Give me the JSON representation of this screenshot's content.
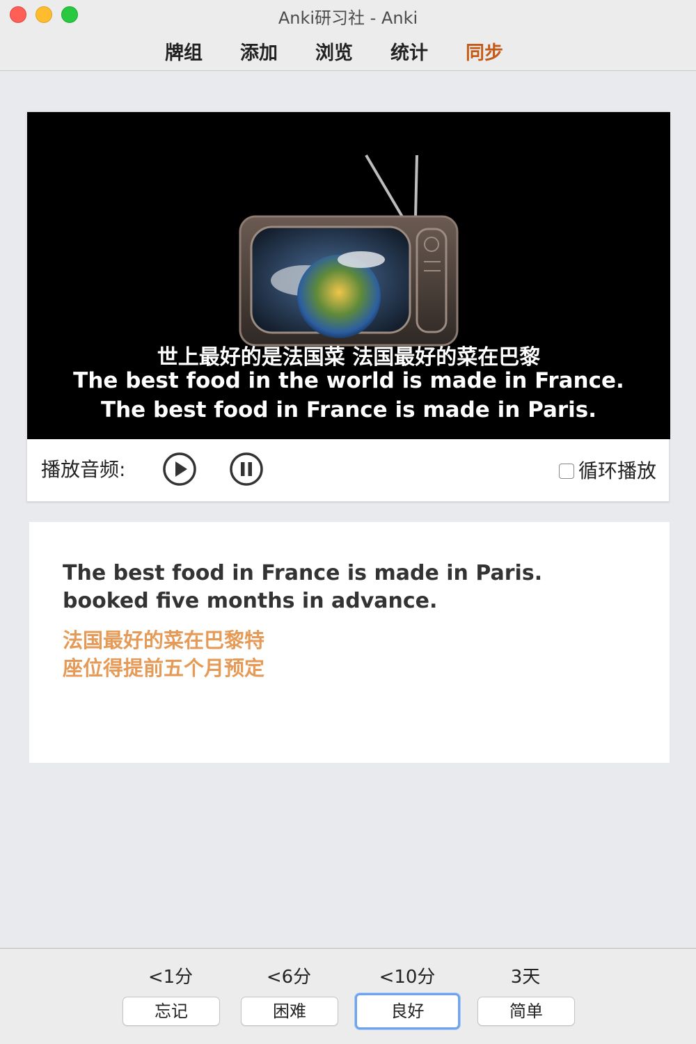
{
  "window": {
    "title": "Anki研习社 - Anki"
  },
  "toolbar": {
    "items": [
      {
        "label": "牌组"
      },
      {
        "label": "添加"
      },
      {
        "label": "浏览"
      },
      {
        "label": "统计"
      },
      {
        "label": "同步",
        "active": true
      }
    ],
    "active_color": "#c35a17"
  },
  "video": {
    "subtitles": [
      "世上最好的是法国菜 法国最好的菜在巴黎",
      "The best food in the world is made in France.",
      "The best food in France is made in Paris."
    ]
  },
  "audio_controls": {
    "label": "播放音频:",
    "play_icon": "play-circle-icon",
    "pause_icon": "pause-circle-icon",
    "loop_label": "循环播放",
    "loop_checked": false
  },
  "card": {
    "english": "The best food in France is made in Paris. booked five months in advance.",
    "chinese_lines": [
      "法国最好的菜在巴黎特",
      "座位得提前五个月预定"
    ],
    "chinese_color": "#e59b57"
  },
  "answer_buttons": [
    {
      "time": "<1分",
      "label": "忘记"
    },
    {
      "time": "<6分",
      "label": "困难"
    },
    {
      "time": "<10分",
      "label": "良好",
      "focused": true
    },
    {
      "time": "3天",
      "label": "简单"
    }
  ]
}
